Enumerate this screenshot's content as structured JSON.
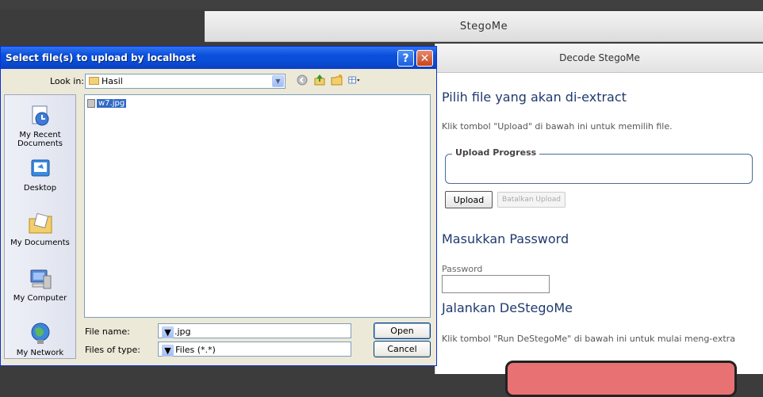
{
  "app": {
    "title": "StegoMe"
  },
  "panel": {
    "header": "Decode StegoMe",
    "section1_title": "Pilih file yang akan di-extract",
    "section1_desc": "Klik tombol \"Upload\" di bawah ini untuk memilih file.",
    "upload_progress_legend": "Upload Progress",
    "upload_button": "Upload",
    "cancel_upload_button": "Batalkan Upload",
    "section2_title": "Masukkan Password",
    "password_label": "Password",
    "password_value": "",
    "section3_title": "Jalankan DeStegoMe",
    "section3_desc": "Klik tombol \"Run DeStegoMe\" di bawah ini untuk mulai meng-extra"
  },
  "dialog": {
    "title": "Select file(s) to upload by localhost",
    "help_glyph": "?",
    "close_glyph": "✕",
    "look_in_label": "Look in:",
    "look_in_value": "Hasil",
    "places": [
      {
        "label": "My Recent Documents",
        "icon": "recent-documents-icon"
      },
      {
        "label": "Desktop",
        "icon": "desktop-icon"
      },
      {
        "label": "My Documents",
        "icon": "my-documents-icon"
      },
      {
        "label": "My Computer",
        "icon": "my-computer-icon"
      },
      {
        "label": "My Network",
        "icon": "my-network-icon"
      }
    ],
    "files": [
      {
        "name": "w7.jpg"
      }
    ],
    "file_name_label": "File name:",
    "file_name_value": "w7.jpg",
    "file_type_label": "Files of type:",
    "file_type_value": "All Files (*.*)",
    "open_button": "Open",
    "cancel_button": "Cancel"
  },
  "colors": {
    "title_bar": "#0a4ddb",
    "selection": "#316ac5",
    "heading": "#1f3a6e",
    "run_button": "#e87173"
  }
}
